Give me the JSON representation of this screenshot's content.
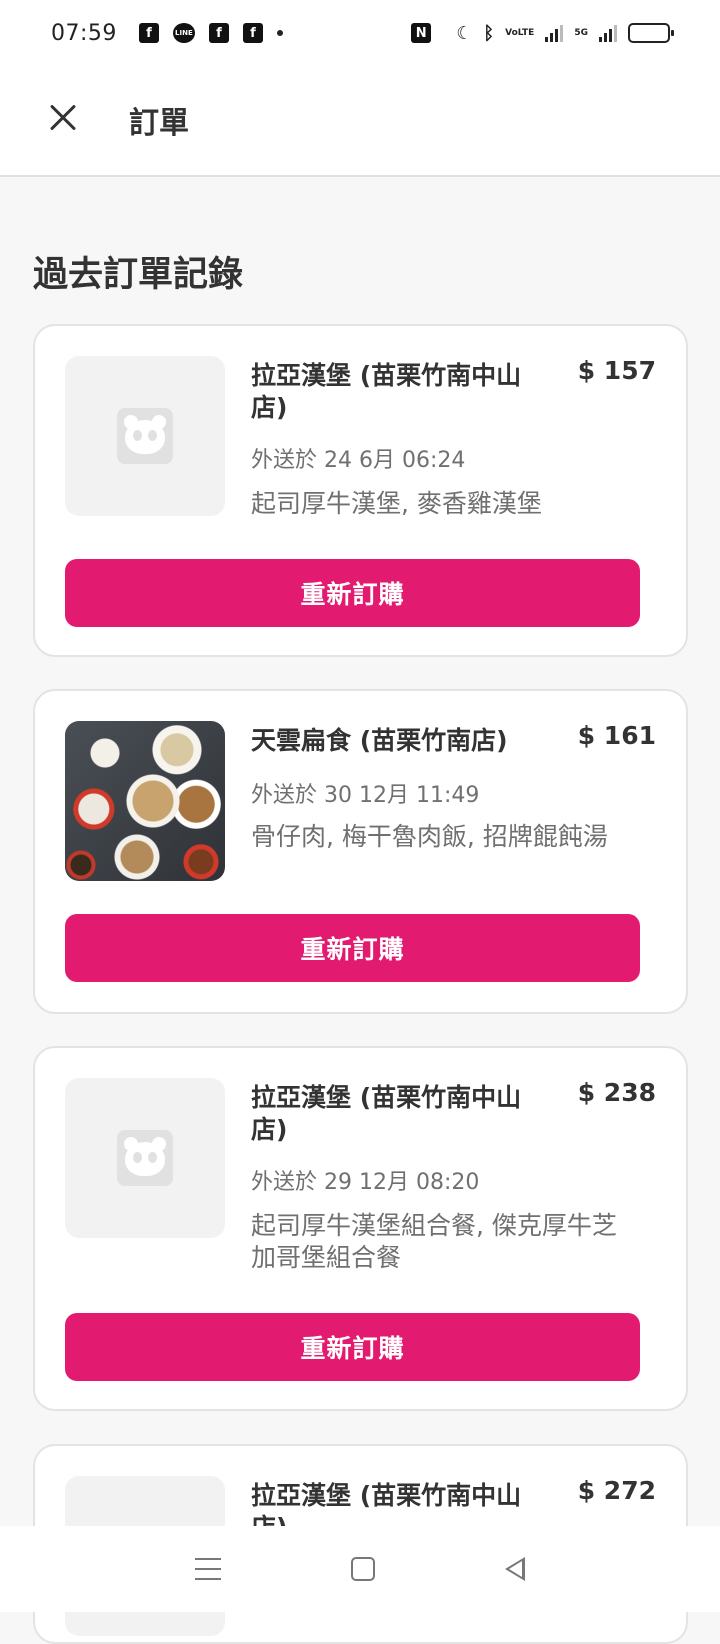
{
  "status_bar": {
    "time": "07:59",
    "icons": [
      "facebook-icon",
      "line-icon",
      "facebook-icon",
      "facebook-icon",
      "dot-icon"
    ],
    "right_icons": [
      "nfc-icon",
      "moon-icon",
      "bluetooth-icon",
      "volte-icon",
      "signal-icon",
      "5g-signal-icon",
      "battery-icon"
    ],
    "volte_label": "VoLTE",
    "network_label": "5G"
  },
  "header": {
    "title": "訂單"
  },
  "section": {
    "title": "過去訂單記錄"
  },
  "orders": [
    {
      "restaurant": "拉亞漢堡 (苗栗竹南中山店)",
      "price": "$ 157",
      "delivered": "外送於 24 6月 06:24",
      "items": "起司厚牛漢堡, 麥香雞漢堡",
      "image": "placeholder-panda-icon",
      "reorder_label": "重新訂購"
    },
    {
      "restaurant": "天雲扁食 (苗栗竹南店)",
      "price": "$ 161",
      "delivered": "外送於 30 12月 11:49",
      "items": "骨仔肉, 梅干魯肉飯, 招牌餛飩湯",
      "image": "food-photo",
      "reorder_label": "重新訂購"
    },
    {
      "restaurant": "拉亞漢堡 (苗栗竹南中山店)",
      "price": "$ 238",
      "delivered": "外送於 29 12月 08:20",
      "items": "起司厚牛漢堡組合餐, 傑克厚牛芝加哥堡組合餐",
      "image": "placeholder-panda-icon",
      "reorder_label": "重新訂購"
    },
    {
      "restaurant": "拉亞漢堡 (苗栗竹南中山店)",
      "price": "$ 272",
      "image": "placeholder-panda-icon"
    }
  ],
  "colors": {
    "accent": "#e21b70",
    "background": "#f7f7f7"
  },
  "nav_bar": {
    "icons": [
      "menu-icon",
      "home-icon",
      "back-icon"
    ]
  }
}
